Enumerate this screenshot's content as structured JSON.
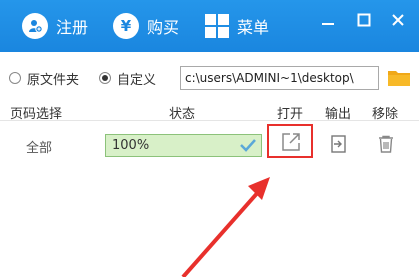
{
  "titlebar": {
    "register_label": "注册",
    "register_icon": "user-add-icon",
    "buy_label": "购买",
    "buy_icon_glyph": "¥",
    "menu_label": "菜单",
    "minimize_glyph": "—",
    "close_glyph": "✕",
    "colors": {
      "background": "#1e8fe6",
      "text": "#ffffff"
    }
  },
  "output_path": {
    "options": [
      {
        "label": "原文件夹",
        "selected": false
      },
      {
        "label": "自定义",
        "selected": true
      }
    ],
    "path_value": "c:\\users\\ADMINI~1\\desktop\\",
    "folder_icon": "folder-icon"
  },
  "table": {
    "headers": {
      "page_select": "页码选择",
      "status": "状态",
      "open": "打开",
      "output": "输出",
      "remove": "移除"
    },
    "rows": [
      {
        "pages": "全部",
        "progress_text": "100%",
        "progress": 1.0,
        "open_icon": "open-external-icon",
        "output_icon": "export-icon",
        "remove_icon": "trash-icon"
      }
    ]
  },
  "colors": {
    "progress_fill": "#d8f0c8",
    "progress_border": "#8cc27a",
    "checkmark": "#5aa8d8",
    "highlight": "#e8302c",
    "arrow": "#e8302c"
  }
}
